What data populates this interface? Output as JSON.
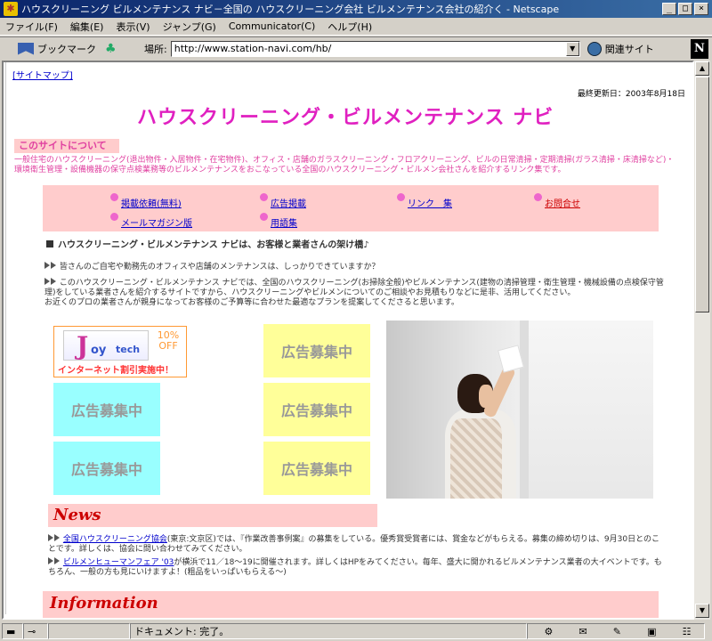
{
  "window": {
    "title": "ハウスクリーニング ビルメンテナンス ナビ－全国の ハウスクリーニング会社 ビルメンテナンス会社の紹介く - Netscape",
    "min": "_",
    "max": "□",
    "close": "×"
  },
  "menu": [
    "ファイル(F)",
    "編集(E)",
    "表示(V)",
    "ジャンプ(G)",
    "Communicator(C)",
    "ヘルプ(H)"
  ],
  "toolbar": {
    "bookmark_label": "ブックマーク",
    "location_label": "場所:",
    "url": "http://www.station-navi.com/hb/",
    "related_label": "関連サイト",
    "netscape_logo": "N"
  },
  "page": {
    "sitemap": "[サイトマップ]",
    "updated": "最終更新日：2003年8月18日",
    "title": "ハウスクリーニング・ビルメンテナンス ナビ",
    "about_heading": "このサイトについて",
    "about_text": "一般住宅のハウスクリーニング(退出物件・入居物件・在宅物件)、オフィス・店舗のガラスクリーニング・フロアクリーニング、ビルの日常清掃・定期清掃(ガラス清掃・床清掃など)・環境衛生管理・設備機器の保守点検業務等のビルメンテナンスをおこなっている全国のハウスクリーニング・ビルメン会社さんを紹介するリンク集です。",
    "nav": {
      "listing": "掲載依頼(無料)",
      "ads": "広告掲載",
      "links": "リンク　集",
      "contact": "お問合せ",
      "magazine": "メールマガジン版",
      "glossary": "用語集"
    },
    "tagline": "ハウスクリーニング・ビルメンテナンス ナビは、お客様と業者さんの架け橋♪",
    "intro1": "皆さんのご自宅や勤務先のオフィスや店舗のメンテナンスは、しっかりできていますか？",
    "intro2": "このハウスクリーニング・ビルメンテナンス ナビでは、全国のハウスクリーニング(お掃除全般)やビルメンテナンス(建物の清掃管理・衛生管理・機械設備の点検保守管理)をしている業者さんを紹介するサイトですから、ハウスクリーニングやビルメンについてのご相談やお見積もりなどに是非、活用してください。",
    "intro3": "お近くのプロの業者さんが親身になってお客様のご予算等に合わせた最適なプランを提案してくださると思います。",
    "ad_text": "広告募集中",
    "joytech": {
      "j": "J",
      "oy": "oy",
      "tech": "tech",
      "off1": "10%",
      "off2": "OFF",
      "banner": "インターネット割引実施中！"
    },
    "news_heading": "News",
    "news1_link": "全国ハウスクリーニング協会",
    "news1_text": "(東京:文京区)では、『作業改善事例案』の募集をしている。優秀賞受賞者には、賞金などがもらえる。募集の締め切りは、9月30日とのことです。詳しくは、協会に問い合わせてみてください。",
    "news2_link": "ビルメンヒューマンフェア '03",
    "news2_text": "が横浜で11／18～19に開催されます。詳しくはHPをみてください。毎年、盛大に開かれるビルメンテナンス業者の大イベントです。もちろん、一般の方も見にいけますよ！(粗品をいっぱいもらえる～)",
    "info_heading": "Information"
  },
  "status": {
    "text": "ドキュメント: 完了。"
  }
}
